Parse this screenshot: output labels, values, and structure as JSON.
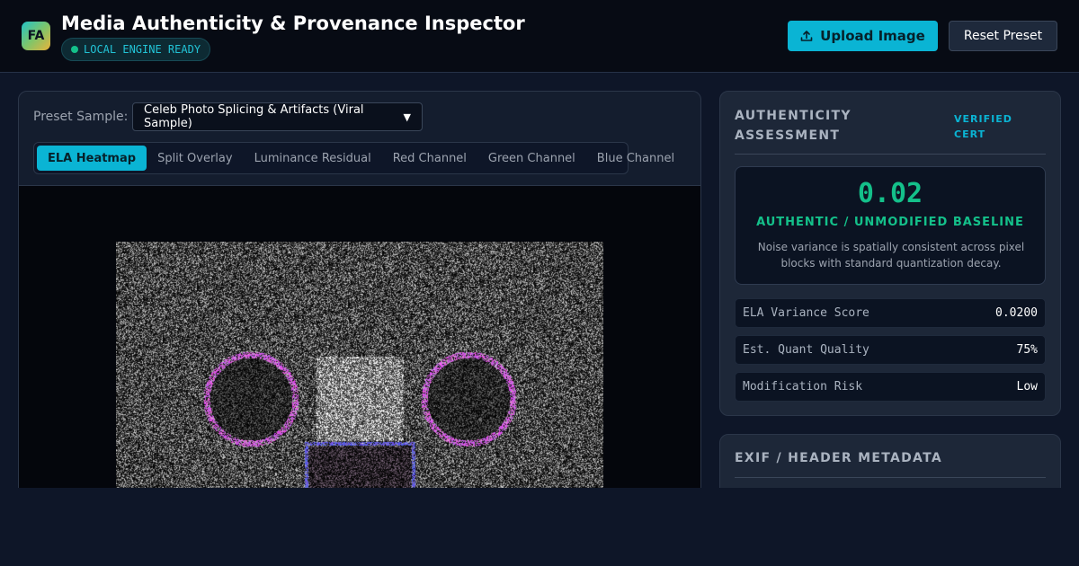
{
  "header": {
    "logo_text": "FA",
    "title": "Media Authenticity & Provenance Inspector",
    "engine_status": "LOCAL ENGINE READY",
    "upload_label": "Upload Image",
    "reset_label": "Reset Preset",
    "upload_icon": "upload-icon"
  },
  "controls": {
    "preset_label": "Preset Sample:",
    "preset_value": "Celeb Photo Splicing & Artifacts (Viral Sample)",
    "tabs": [
      {
        "label": "ELA Heatmap",
        "active": true
      },
      {
        "label": "Split Overlay",
        "active": false
      },
      {
        "label": "Luminance Residual",
        "active": false
      },
      {
        "label": "Red Channel",
        "active": false
      },
      {
        "label": "Green Channel",
        "active": false
      },
      {
        "label": "Blue Channel",
        "active": false
      }
    ]
  },
  "assessment": {
    "title": "AUTHENTICITY ASSESSMENT",
    "cert": "VERIFIED CERT",
    "score": "0.02",
    "verdict": "AUTHENTIC / UNMODIFIED BASELINE",
    "description": "Noise variance is spatially consistent across pixel blocks with standard quantization decay.",
    "metrics": [
      {
        "label": "ELA Variance Score",
        "value": "0.0200"
      },
      {
        "label": "Est. Quant Quality",
        "value": "75%"
      },
      {
        "label": "Modification Risk",
        "value": "Low"
      }
    ],
    "score_color": "#14c08a"
  },
  "exif": {
    "title": "EXIF / HEADER METADATA"
  },
  "colors": {
    "accent": "#0ab4d4",
    "success": "#14c08a",
    "background": "#0e1628"
  }
}
